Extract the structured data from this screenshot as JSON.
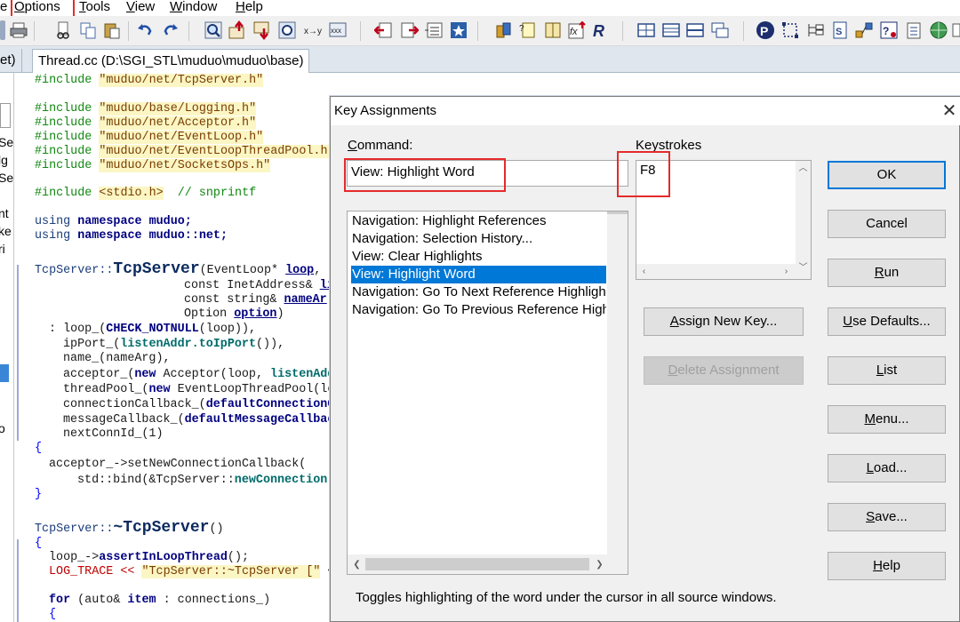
{
  "menubar": {
    "items": [
      {
        "id": "options",
        "label": "Options",
        "mnemonic": "O",
        "rest": "ptions"
      },
      {
        "id": "tools",
        "label": "Tools",
        "mnemonic": "T",
        "rest": "ools"
      },
      {
        "id": "view",
        "label": "View",
        "mnemonic": "V",
        "rest": "iew"
      },
      {
        "id": "window",
        "label": "Window",
        "mnemonic": "W",
        "rest": "indow"
      },
      {
        "id": "help",
        "label": "Help",
        "mnemonic": "H",
        "rest": "elp"
      }
    ],
    "partial_left": "e"
  },
  "tabs": {
    "partial": "et)",
    "active": "Thread.cc (D:\\SGI_STL\\muduo\\muduo\\base)"
  },
  "left_panel": {
    "fragments": [
      "Se",
      "lg",
      "Se",
      "nt",
      "ke",
      "ri",
      "o"
    ]
  },
  "code": {
    "l1": "#include",
    "l1s": "\"muduo/net/TcpServer.h\"",
    "l2": "#include",
    "l2s": "\"muduo/base/Logging.h\"",
    "l3": "#include",
    "l3s": "\"muduo/net/Acceptor.h\"",
    "l4": "#include",
    "l4s": "\"muduo/net/EventLoop.h\"",
    "l5": "#include",
    "l5s": "\"muduo/net/EventLoopThreadPool.h\"",
    "l6": "#include",
    "l6s": "\"muduo/net/SocketsOps.h\"",
    "l7": "#include",
    "l7s": "<stdio.h>",
    "l7c": "// snprintf",
    "l8a": "using",
    "l8b": "namespace",
    "l8c": "muduo;",
    "l9a": "using",
    "l9b": "namespace",
    "l9c": "muduo::net;",
    "l10a": "TcpServer::",
    "l10b": "TcpServer",
    "l10c": "(EventLoop* ",
    "l10d": "loop",
    "l10e": ",",
    "l11a": "const InetAddress& ",
    "l11b": "li",
    "l12a": "const string& ",
    "l12b": "nameAr",
    "l13a": "Option ",
    "l13b": "option",
    "l13c": ")",
    "l14a": ": loop_(",
    "l14b": "CHECK_NOTNULL",
    "l14c": "(loop)),",
    "l15a": "ipPort_(",
    "l15b": "listenAddr.",
    "l15c": "toIpPort",
    "l15d": "()),",
    "l16a": "name_(nameArg),",
    "l17a": "acceptor_(",
    "l17b": "new",
    "l17c": " Acceptor(loop, ",
    "l17d": "listenAdd",
    "l18a": "threadPool_(",
    "l18b": "new",
    "l18c": " EventLoopThreadPool(lo",
    "l19a": "connectionCallback_(",
    "l19b": "defaultConnectionC",
    "l20a": "messageCallback_(",
    "l20b": "defaultMessageCallbac",
    "l21a": "nextConnId_(1)",
    "l22": "{",
    "l23a": "acceptor_->setNewConnectionCallback(",
    "l24a": "std::bind(&TcpServer::",
    "l24b": "newConnection",
    "l24c": ",",
    "l25": "}",
    "l26a": "TcpServer::",
    "l26b": "~TcpServer",
    "l26c": "()",
    "l27": "{",
    "l28a": "loop_->",
    "l28b": "assertInLoopThread",
    "l28c": "();",
    "l29a": "LOG_TRACE << ",
    "l29b": "\"TcpServer::~TcpServer [\"",
    "l29c": " <",
    "l30a": "for",
    "l30b": " (auto& ",
    "l30c": "item",
    "l30d": " : connections_)",
    "l31": "{"
  },
  "dialog": {
    "title": "Key Assignments",
    "command_label": "Command:",
    "command_mnemonic": "C",
    "command_rest": "ommand:",
    "command_value": "View: Highlight Word",
    "keystrokes_label": "Keystrokes",
    "keystroke_value": "F8",
    "commands": [
      "Navigation: Highlight References",
      "Navigation: Selection History...",
      "View: Clear Highlights",
      "View: Highlight Word",
      "Navigation: Go To Next Reference Highlight",
      "Navigation: Go To Previous Reference Highlight"
    ],
    "selected_index": 3,
    "buttons": {
      "ok": "OK",
      "cancel": "Cancel",
      "run": "Run",
      "run_m": "R",
      "run_r": "un",
      "use_defaults": "Use Defaults...",
      "ud_m": "U",
      "ud_r": "se Defaults...",
      "list": "List",
      "list_m": "L",
      "list_r": "ist",
      "menu": "Menu...",
      "menu_m": "M",
      "menu_r": "enu...",
      "load": "Load...",
      "load_m": "L",
      "load_r": "oad...",
      "save": "Save...",
      "save_m": "S",
      "save_r": "ave...",
      "help": "Help",
      "help_m": "H",
      "help_r": "elp",
      "assign": "Assign New Key...",
      "assign_m": "A",
      "assign_r": "ssign New Key...",
      "delete": "Delete Assignment",
      "delete_m": "D",
      "delete_r": "elete Assignment"
    },
    "description": "Toggles highlighting of the word under the cursor in all source windows."
  },
  "colors": {
    "accent": "#0078d7",
    "highlight_box": "#e52b2b",
    "string_bg": "#fbf6c4"
  }
}
